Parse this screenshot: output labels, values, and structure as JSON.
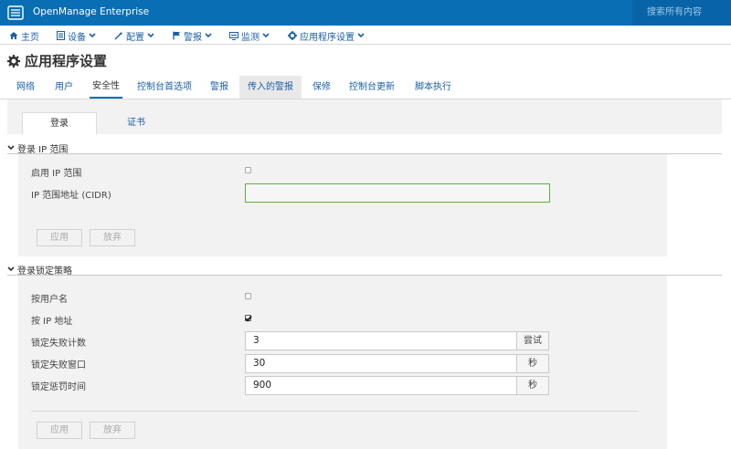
{
  "app": {
    "title": "OpenManage Enterprise",
    "search_placeholder": "搜索所有内容"
  },
  "nav": {
    "home": "主页",
    "devices": "设备",
    "configuration": "配置",
    "alerts": "警报",
    "monitor": "监测",
    "app_settings": "应用程序设置"
  },
  "page": {
    "title": "应用程序设置"
  },
  "tabs": [
    "网络",
    "用户",
    "安全性",
    "控制台首选项",
    "警报",
    "传入的警报",
    "保修",
    "控制台更新",
    "脚本执行"
  ],
  "active_tab": "安全性",
  "subtabs": {
    "login": "登录",
    "certificate": "证书"
  },
  "login_ip_range": {
    "header": "登录 IP 范围",
    "enable_label": "启用 IP 范围",
    "enable_checked": false,
    "cidr_label": "IP 范围地址 (CIDR)",
    "cidr_value": "",
    "apply": "应用",
    "discard": "放弃"
  },
  "lockout_policy": {
    "header": "登录锁定策略",
    "by_username_label": "按用户名",
    "by_username_checked": false,
    "by_ip_label": "按 IP 地址",
    "by_ip_checked": true,
    "fail_count_label": "锁定失败计数",
    "fail_count_value": "3",
    "fail_count_unit": "尝试",
    "fail_window_label": "锁定失败窗口",
    "fail_window_value": "30",
    "fail_window_unit": "秒",
    "penalty_label": "锁定惩罚时间",
    "penalty_value": "900",
    "penalty_unit": "秒",
    "apply": "应用",
    "discard": "放弃"
  },
  "colors": {
    "brand": "#0a6eb4",
    "link": "#1a5fa5",
    "panel": "#f2f2f2",
    "valid_border": "#5fae43"
  }
}
